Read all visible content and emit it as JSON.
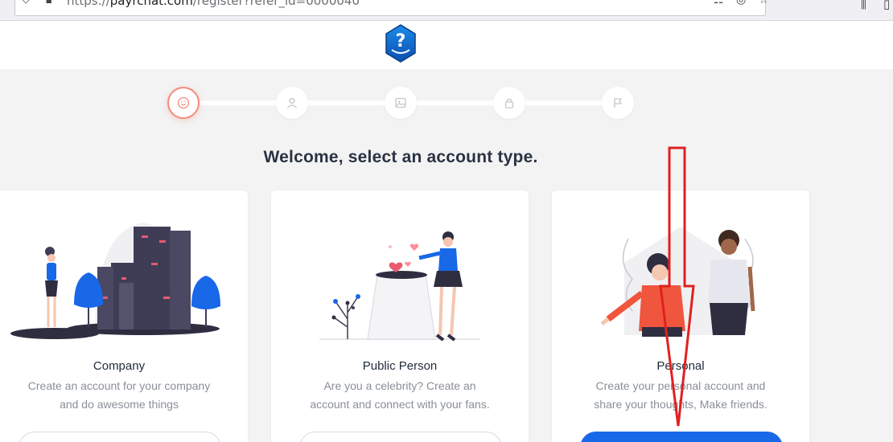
{
  "browser": {
    "url_prefix": "https://",
    "url_domain": "payrchat.com",
    "url_path": "/register?refer_id=0000040"
  },
  "stepper": {
    "steps": [
      {
        "icon": "smiley-icon",
        "active": true
      },
      {
        "icon": "user-icon",
        "active": false
      },
      {
        "icon": "image-icon",
        "active": false
      },
      {
        "icon": "lock-icon",
        "active": false
      },
      {
        "icon": "flag-icon",
        "active": false
      }
    ]
  },
  "main": {
    "title": "Welcome, select an account type.",
    "cards": [
      {
        "title": "Company",
        "desc_line1": "Create an account for your company",
        "desc_line2": "and do awesome things"
      },
      {
        "title": "Public Person",
        "desc_line1": "Are you a celebrity? Create an",
        "desc_line2": "account and connect with your fans."
      },
      {
        "title": "Personal",
        "desc_line1": "Create your personal account and",
        "desc_line2": "share your thoughts, Make friends."
      }
    ]
  },
  "colors": {
    "primary": "#1868e8",
    "accent": "#f28b7d",
    "annotation": "#e02020"
  }
}
